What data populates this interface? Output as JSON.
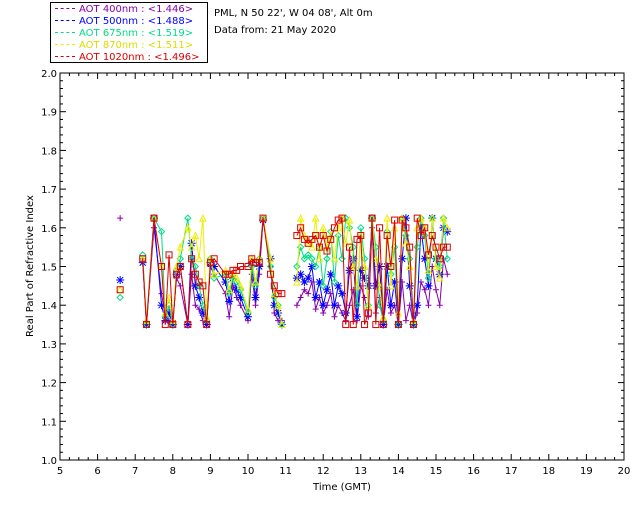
{
  "header": {
    "site": "PML, N 50 22', W 04 08', Alt 0m",
    "date": "Data from: 21 May 2020"
  },
  "legend": [
    {
      "label": "AOT  400nm : <1.446>",
      "color": "#8800aa"
    },
    {
      "label": "AOT  500nm : <1.488>",
      "color": "#0000ff"
    },
    {
      "label": "AOT  675nm : <1.519>",
      "color": "#00dd88"
    },
    {
      "label": "AOT  870nm : <1.511>",
      "color": "#eeee00"
    },
    {
      "label": "AOT 1020nm : <1.496>",
      "color": "#dd0000"
    }
  ],
  "chart_data": {
    "type": "line",
    "xlabel": "Time (GMT)",
    "ylabel": "Real Part of Refractive Index",
    "xlim": [
      5,
      20
    ],
    "ylim": [
      1.0,
      2.0
    ],
    "xticks": [
      "5",
      "6",
      "7",
      "8",
      "9",
      "10",
      "11",
      "12",
      "13",
      "14",
      "15",
      "16",
      "17",
      "18",
      "19",
      "20"
    ],
    "yticks": [
      "1.0",
      "1.1",
      "1.2",
      "1.3",
      "1.4",
      "1.5",
      "1.6",
      "1.7",
      "1.8",
      "1.9",
      "2.0"
    ],
    "x": [
      6.6,
      7.2,
      7.3,
      7.5,
      7.7,
      7.8,
      7.9,
      8.0,
      8.1,
      8.2,
      8.4,
      8.5,
      8.6,
      8.7,
      8.8,
      8.9,
      9.0,
      9.1,
      9.4,
      9.5,
      9.6,
      9.7,
      9.8,
      10.0,
      10.1,
      10.2,
      10.3,
      10.4,
      10.6,
      10.7,
      10.8,
      10.9,
      11.3,
      11.4,
      11.5,
      11.6,
      11.7,
      11.8,
      11.9,
      12.0,
      12.1,
      12.2,
      12.3,
      12.4,
      12.5,
      12.6,
      12.7,
      12.8,
      12.9,
      13.0,
      13.1,
      13.2,
      13.3,
      13.4,
      13.5,
      13.6,
      13.7,
      13.8,
      13.9,
      14.0,
      14.1,
      14.2,
      14.3,
      14.4,
      14.5,
      14.6,
      14.7,
      14.8,
      14.9,
      15.0,
      15.1,
      15.2,
      15.3
    ],
    "series": [
      {
        "name": "AOT  400nm",
        "color": "#8800aa",
        "marker": "plus",
        "values": [
          1.625,
          1.52,
          1.35,
          1.6,
          1.43,
          1.37,
          1.36,
          1.36,
          1.47,
          1.45,
          1.35,
          1.48,
          1.4,
          1.39,
          1.36,
          1.35,
          1.5,
          1.48,
          1.43,
          1.37,
          1.45,
          1.42,
          1.4,
          1.36,
          1.48,
          1.4,
          1.48,
          1.62,
          1.5,
          1.38,
          1.36,
          1.36,
          1.4,
          1.42,
          1.44,
          1.43,
          1.46,
          1.39,
          1.42,
          1.38,
          1.4,
          1.43,
          1.37,
          1.4,
          1.38,
          1.36,
          1.4,
          1.44,
          1.36,
          1.45,
          1.42,
          1.37,
          1.6,
          1.38,
          1.42,
          1.35,
          1.44,
          1.38,
          1.4,
          1.35,
          1.46,
          1.36,
          1.4,
          1.35,
          1.38,
          1.46,
          1.44,
          1.4,
          1.5,
          1.44,
          1.4,
          1.52,
          1.48
        ]
      },
      {
        "name": "AOT  500nm",
        "color": "#0000ff",
        "marker": "star",
        "values": [
          1.465,
          1.51,
          1.35,
          1.625,
          1.4,
          1.36,
          1.38,
          1.35,
          1.48,
          1.5,
          1.35,
          1.56,
          1.45,
          1.42,
          1.38,
          1.35,
          1.51,
          1.5,
          1.46,
          1.41,
          1.47,
          1.44,
          1.42,
          1.37,
          1.51,
          1.42,
          1.5,
          1.62,
          1.52,
          1.4,
          1.38,
          1.35,
          1.47,
          1.48,
          1.46,
          1.47,
          1.5,
          1.42,
          1.46,
          1.4,
          1.44,
          1.48,
          1.4,
          1.45,
          1.43,
          1.38,
          1.49,
          1.52,
          1.37,
          1.49,
          1.47,
          1.45,
          1.625,
          1.45,
          1.5,
          1.35,
          1.5,
          1.4,
          1.46,
          1.35,
          1.52,
          1.625,
          1.45,
          1.35,
          1.4,
          1.6,
          1.52,
          1.45,
          1.625,
          1.52,
          1.48,
          1.6,
          1.59
        ]
      },
      {
        "name": "AOT  675nm",
        "color": "#00dd88",
        "marker": "diamond",
        "values": [
          1.42,
          1.53,
          1.35,
          1.625,
          1.59,
          1.37,
          1.4,
          1.35,
          1.49,
          1.52,
          1.625,
          1.52,
          1.5,
          1.45,
          1.4,
          1.36,
          1.52,
          1.47,
          1.48,
          1.43,
          1.47,
          1.46,
          1.44,
          1.38,
          1.5,
          1.45,
          1.52,
          1.625,
          1.5,
          1.42,
          1.4,
          1.35,
          1.5,
          1.55,
          1.52,
          1.53,
          1.52,
          1.5,
          1.55,
          1.45,
          1.52,
          1.59,
          1.46,
          1.58,
          1.52,
          1.625,
          1.6,
          1.55,
          1.4,
          1.6,
          1.52,
          1.4,
          1.625,
          1.55,
          1.4,
          1.36,
          1.59,
          1.48,
          1.55,
          1.35,
          1.625,
          1.58,
          1.52,
          1.35,
          1.55,
          1.625,
          1.58,
          1.47,
          1.625,
          1.52,
          1.5,
          1.625,
          1.52
        ]
      },
      {
        "name": "AOT  870nm",
        "color": "#eeee00",
        "marker": "triangle",
        "values": [
          1.44,
          1.52,
          1.36,
          1.625,
          1.5,
          1.38,
          1.42,
          1.36,
          1.5,
          1.55,
          1.6,
          1.55,
          1.58,
          1.52,
          1.625,
          1.37,
          1.52,
          1.48,
          1.49,
          1.44,
          1.48,
          1.47,
          1.45,
          1.39,
          1.52,
          1.46,
          1.52,
          1.625,
          1.52,
          1.43,
          1.4,
          1.35,
          1.46,
          1.625,
          1.58,
          1.56,
          1.55,
          1.625,
          1.52,
          1.6,
          1.55,
          1.58,
          1.52,
          1.6,
          1.625,
          1.56,
          1.62,
          1.5,
          1.45,
          1.58,
          1.5,
          1.4,
          1.625,
          1.52,
          1.45,
          1.37,
          1.625,
          1.45,
          1.6,
          1.38,
          1.625,
          1.56,
          1.5,
          1.36,
          1.6,
          1.625,
          1.6,
          1.49,
          1.625,
          1.5,
          1.47,
          1.625,
          1.6
        ]
      },
      {
        "name": "AOT 1020nm",
        "color": "#dd0000",
        "marker": "square",
        "values": [
          1.44,
          1.52,
          1.35,
          1.625,
          1.5,
          1.35,
          1.53,
          1.35,
          1.48,
          1.5,
          1.35,
          1.52,
          1.48,
          1.46,
          1.45,
          1.35,
          1.51,
          1.52,
          1.48,
          1.48,
          1.49,
          1.49,
          1.5,
          1.5,
          1.52,
          1.51,
          1.51,
          1.625,
          1.48,
          1.45,
          1.43,
          1.43,
          1.58,
          1.6,
          1.57,
          1.56,
          1.57,
          1.58,
          1.55,
          1.58,
          1.54,
          1.57,
          1.6,
          1.62,
          1.625,
          1.35,
          1.55,
          1.35,
          1.57,
          1.58,
          1.35,
          1.38,
          1.625,
          1.35,
          1.6,
          1.35,
          1.58,
          1.5,
          1.62,
          1.35,
          1.62,
          1.6,
          1.55,
          1.35,
          1.625,
          1.58,
          1.6,
          1.53,
          1.58,
          1.55,
          1.52,
          1.55,
          1.55
        ]
      }
    ]
  }
}
